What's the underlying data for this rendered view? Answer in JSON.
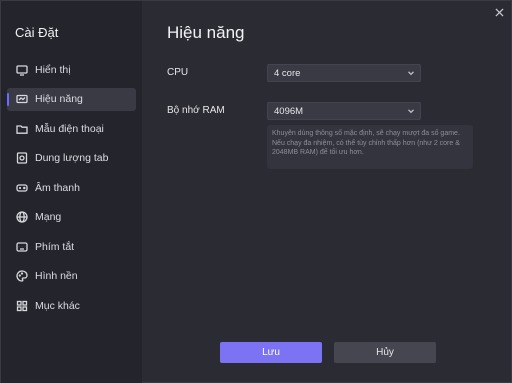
{
  "sidebar": {
    "title": "Cài Đặt",
    "items": [
      {
        "label": "Hiển thị",
        "icon": "monitor-icon",
        "active": false
      },
      {
        "label": "Hiệu năng",
        "icon": "performance-icon",
        "active": true
      },
      {
        "label": "Mẫu điện thoại",
        "icon": "folder-icon",
        "active": false
      },
      {
        "label": "Dung lượng tab",
        "icon": "storage-icon",
        "active": false
      },
      {
        "label": "Âm thanh",
        "icon": "gamepad-icon",
        "active": false
      },
      {
        "label": "Mạng",
        "icon": "globe-icon",
        "active": false
      },
      {
        "label": "Phím tắt",
        "icon": "keyboard-icon",
        "active": false
      },
      {
        "label": "Hình nền",
        "icon": "palette-icon",
        "active": false
      },
      {
        "label": "Mục khác",
        "icon": "grid-icon",
        "active": false
      }
    ]
  },
  "main": {
    "title": "Hiệu năng",
    "cpu": {
      "label": "CPU",
      "value": "4 core"
    },
    "ram": {
      "label": "Bộ nhớ RAM",
      "value": "4096M"
    },
    "hint": {
      "line1": "Khuyên dùng thông số mặc định, sẽ chạy mượt đa số game.",
      "line2": "Nếu chạy đa nhiệm, có thể tùy chỉnh thấp hơn (như 2 core & 2048MB RAM) để tối ưu hơn."
    }
  },
  "buttons": {
    "save": "Lưu",
    "cancel": "Hủy"
  },
  "colors": {
    "accent": "#7b73f4",
    "sidebar_bg": "#24242c",
    "main_bg": "#2b2b33"
  }
}
